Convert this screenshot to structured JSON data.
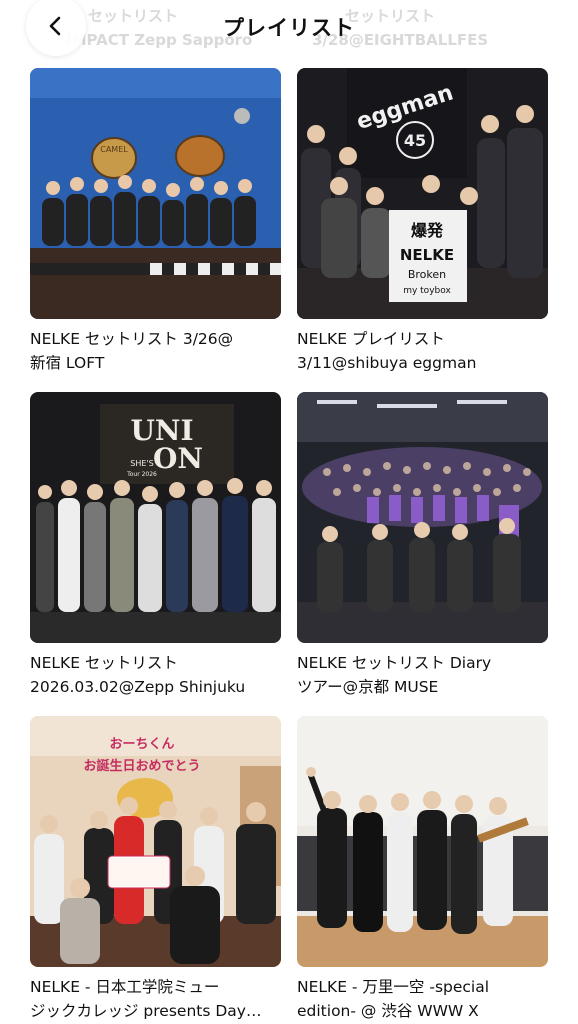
{
  "header": {
    "title": "プレイリスト",
    "back_icon": "chevron-left-icon"
  },
  "background_labels": [
    "セットリスト",
    "IMPACT Zepp Sapporo",
    "セットリスト",
    "3/28@EIGHTBALLFES"
  ],
  "playlists": [
    {
      "line1": "NELKE セットリスト 3/26@",
      "line2": "新宿 LOFT",
      "sign_text": "CAMEL"
    },
    {
      "line1": "NELKE プレイリスト",
      "line2": "3/11@shibuya eggman",
      "banner_text": "eggman",
      "badge_text": "45",
      "board_line1": "爆発",
      "board_line2": "NELKE",
      "board_line3": "Broken",
      "board_line4": "my toybox"
    },
    {
      "line1": "NELKE セットリスト",
      "line2": "2026.03.02@Zepp Shinjuku",
      "banner_top": "UNI",
      "banner_bottom": "ON",
      "banner_sub": "SHE'S",
      "banner_tour": "Tour 2026"
    },
    {
      "line1": "NELKE セットリスト Diary",
      "line2": "ツアー@京都 MUSE"
    },
    {
      "line1": "NELKE - 日本工学院ミュー",
      "line2": "ジックカレッジ presents Day…",
      "wall_line1": "おーちくん",
      "wall_line2": "お誕生日おめでとう"
    },
    {
      "line1": "NELKE - 万里一空 -special",
      "line2": "edition- @ 渋谷 WWW X"
    }
  ]
}
